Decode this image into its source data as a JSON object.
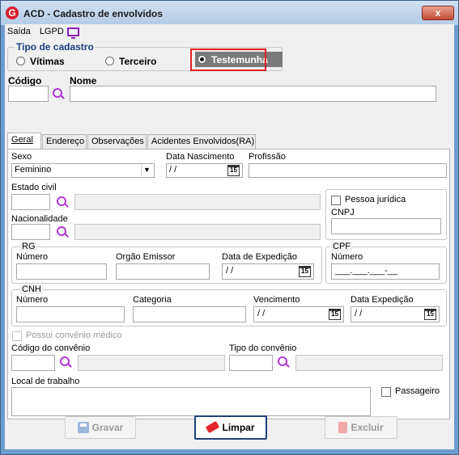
{
  "window": {
    "title": "ACD - Cadastro de envolvidos",
    "close_label": "x"
  },
  "menu": {
    "saida": "Saída",
    "lgpd": "LGPD"
  },
  "tipo_cadastro": {
    "label": "Tipo de cadastro",
    "options": [
      "Vítimas",
      "Terceiro",
      "Testemunha"
    ],
    "selected": "Testemunha"
  },
  "codigo": {
    "label": "Código",
    "value": ""
  },
  "nome": {
    "label": "Nome",
    "value": ""
  },
  "tabs": [
    "Geral",
    "Endereço",
    "Observações",
    "Acidentes Envolvidos(RA)"
  ],
  "geral": {
    "sexo": {
      "label": "Sexo",
      "value": "Feminino"
    },
    "data_nascimento": {
      "label": "Data Nascimento",
      "value": " / /"
    },
    "profissao": {
      "label": "Profissão",
      "value": ""
    },
    "estado_civil": {
      "label": "Estado civil",
      "value": ""
    },
    "nacionalidade": {
      "label": "Nacionalidade",
      "value": ""
    },
    "pessoa_juridica": {
      "label": "Pessoa jurídica"
    },
    "cnpj": {
      "label": "CNPJ",
      "value": ""
    },
    "rg": {
      "label": "RG",
      "numero_label": "Número",
      "orgao_label": "Orgão Emissor",
      "data_label": "Data de Expedição",
      "data_value": " / /"
    },
    "cpf": {
      "label": "CPF",
      "numero_label": "Número",
      "value": "___.___.___-__"
    },
    "cnh": {
      "label": "CNH",
      "numero_label": "Número",
      "categoria_label": "Categoria",
      "vencimento_label": "Vencimento",
      "vencimento_value": " / /",
      "data_label": "Data Expedição",
      "data_value": " / /"
    },
    "convenio_medico": {
      "label": "Possui convênio médico"
    },
    "codigo_convenio": {
      "label": "Código do convênio"
    },
    "tipo_convenio": {
      "label": "Tipo do convênio"
    },
    "local_trabalho": {
      "label": "Local de trabalho"
    },
    "passageiro": {
      "label": "Passageiro"
    }
  },
  "calendar_glyph": "15",
  "buttons": {
    "gravar": "Gravar",
    "limpar": "Limpar",
    "excluir": "Excluir"
  },
  "icons": {
    "app": "app-logo-icon",
    "monitor": "monitor-icon",
    "search": "magnifier-icon",
    "calendar": "calendar-icon",
    "save": "save-icon",
    "eraser": "eraser-icon",
    "trash": "trash-icon"
  }
}
